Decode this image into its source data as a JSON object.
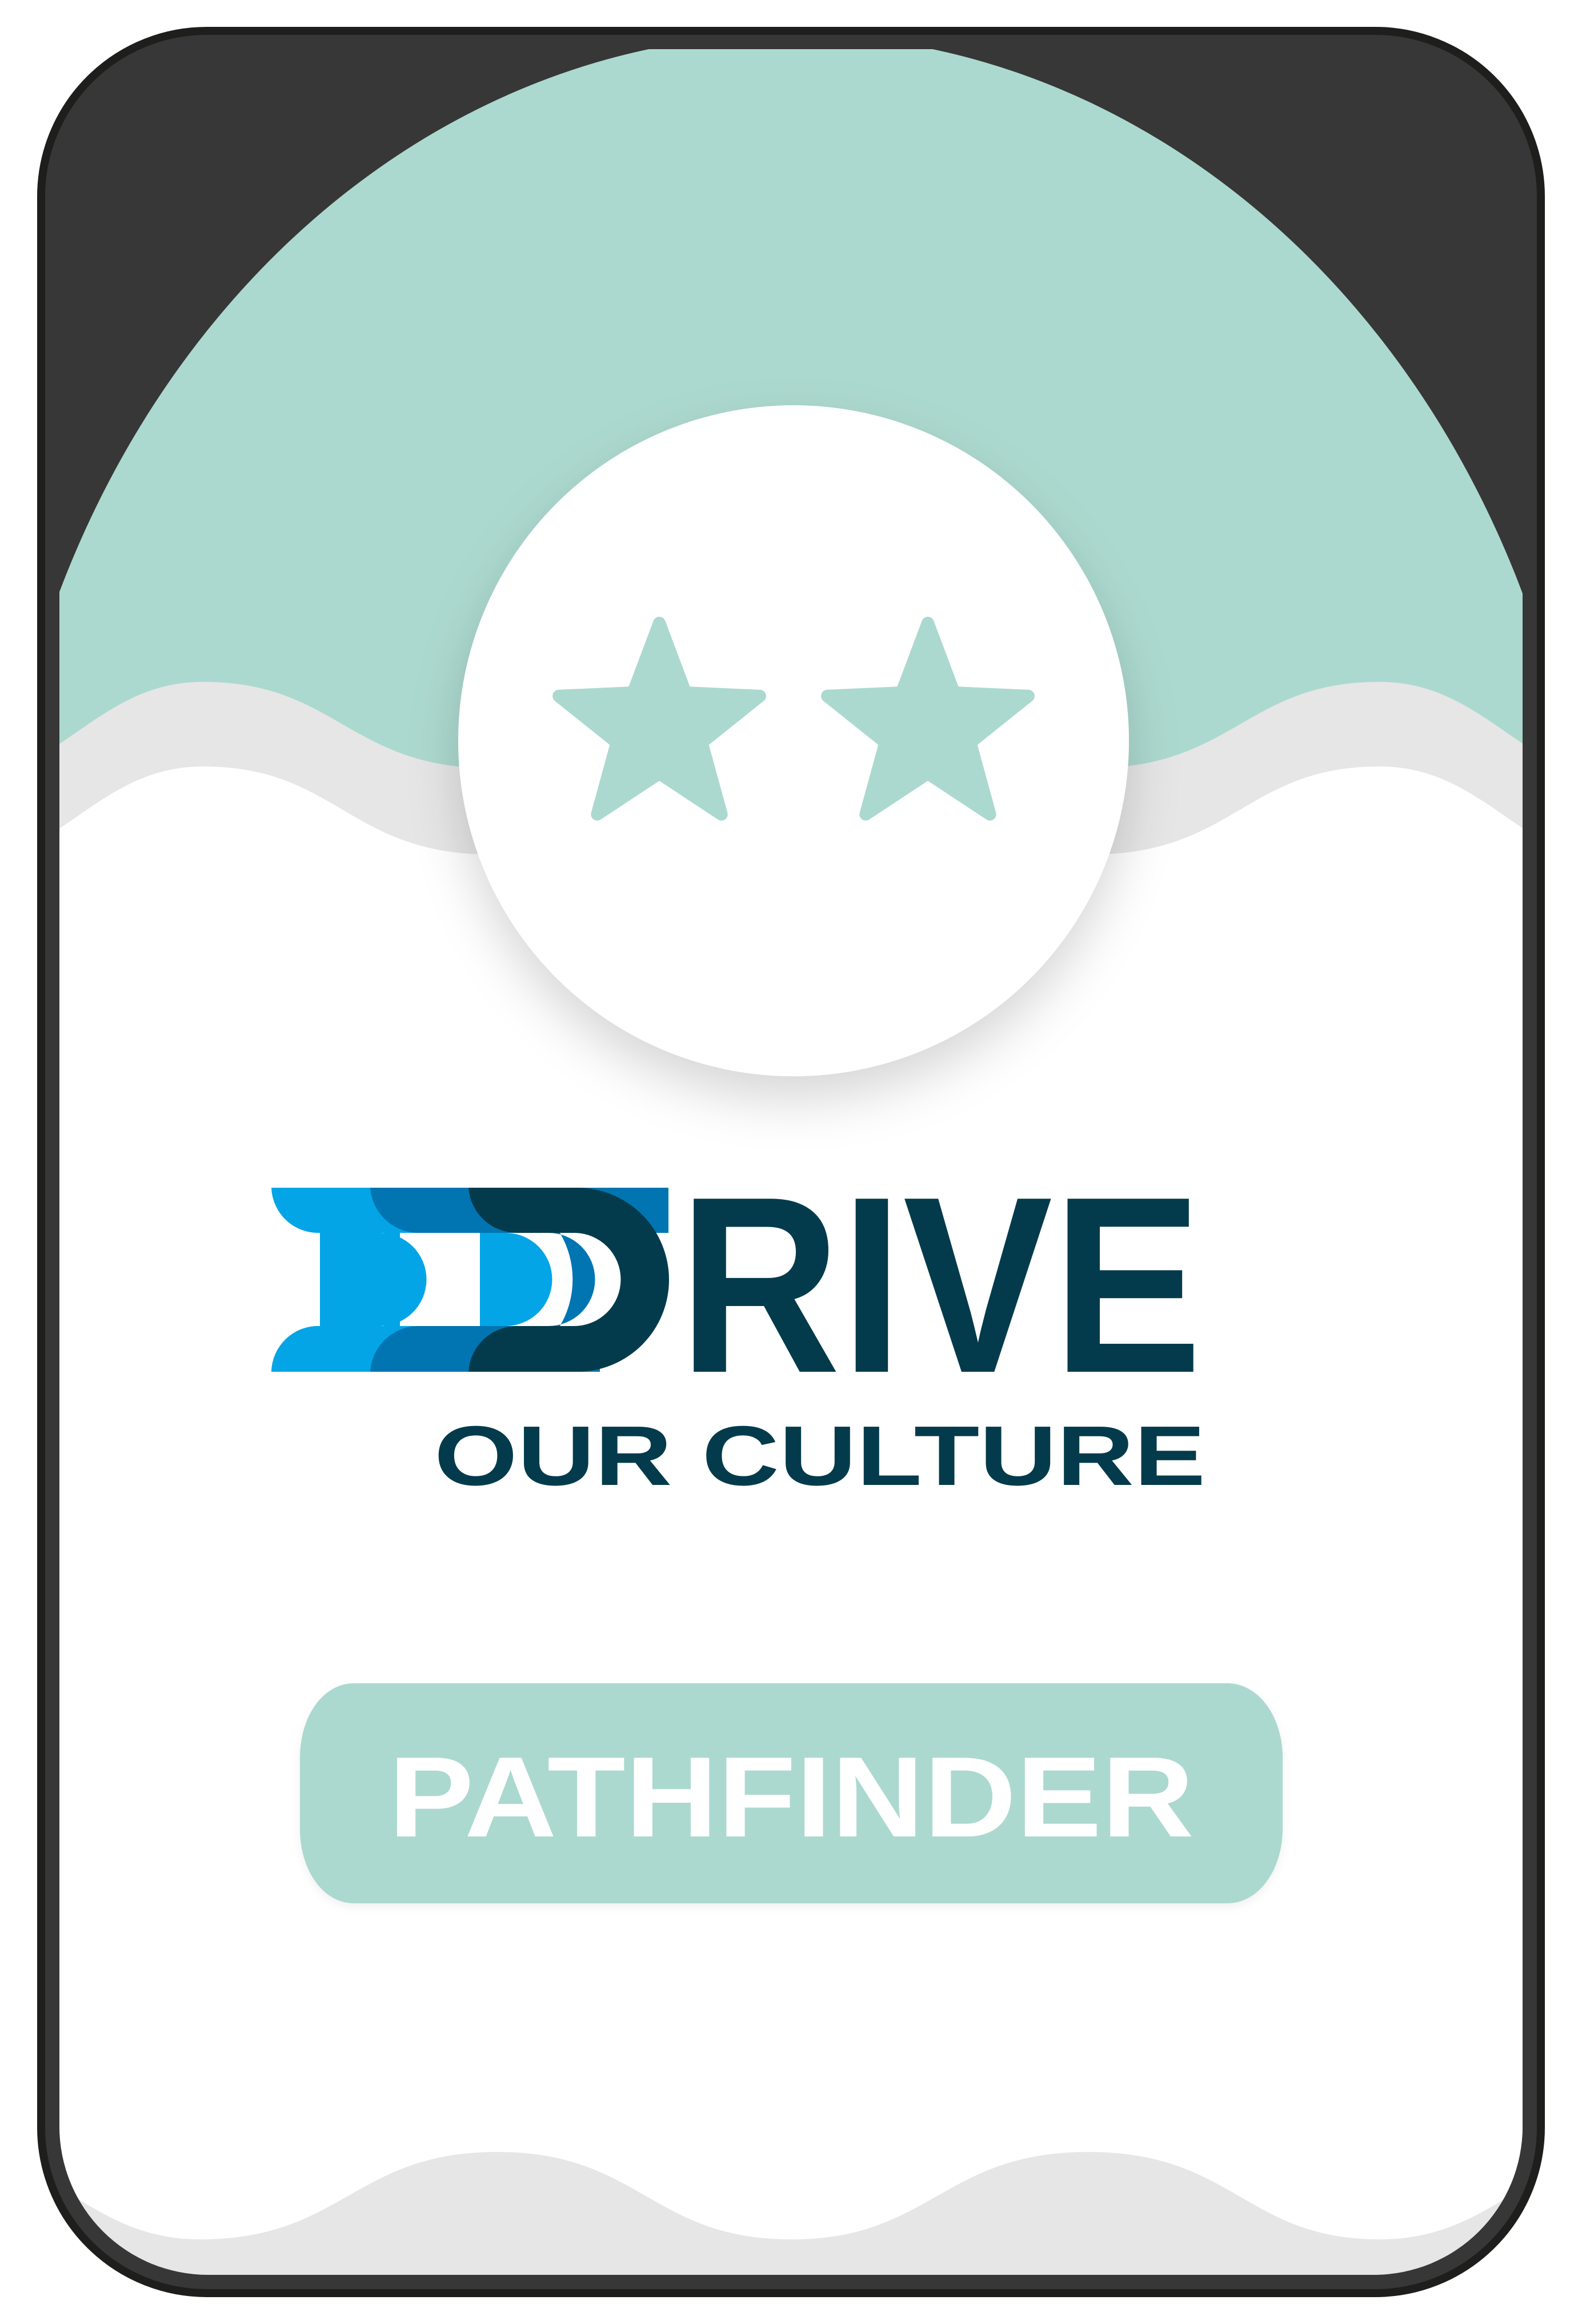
{
  "badge": {
    "stars_filled": 2,
    "star_icon": "star-icon",
    "colors": {
      "frame": "#373737",
      "frame_border": "#1e1e1c",
      "mint": "#acd9cf",
      "wave_shadow": "#e6e6e6",
      "card_white": "#ffffff"
    }
  },
  "logo": {
    "word": "DRIVE",
    "word_rest": "RIVE",
    "tagline": "OUR CULTURE",
    "colors": {
      "navy": "#033b4c",
      "blue_light": "#03a5e6",
      "blue_mid": "#0075b1"
    }
  },
  "level": {
    "label": "PATHFINDER",
    "pill_color": "#acd9cf",
    "text_color": "#ffffff"
  }
}
